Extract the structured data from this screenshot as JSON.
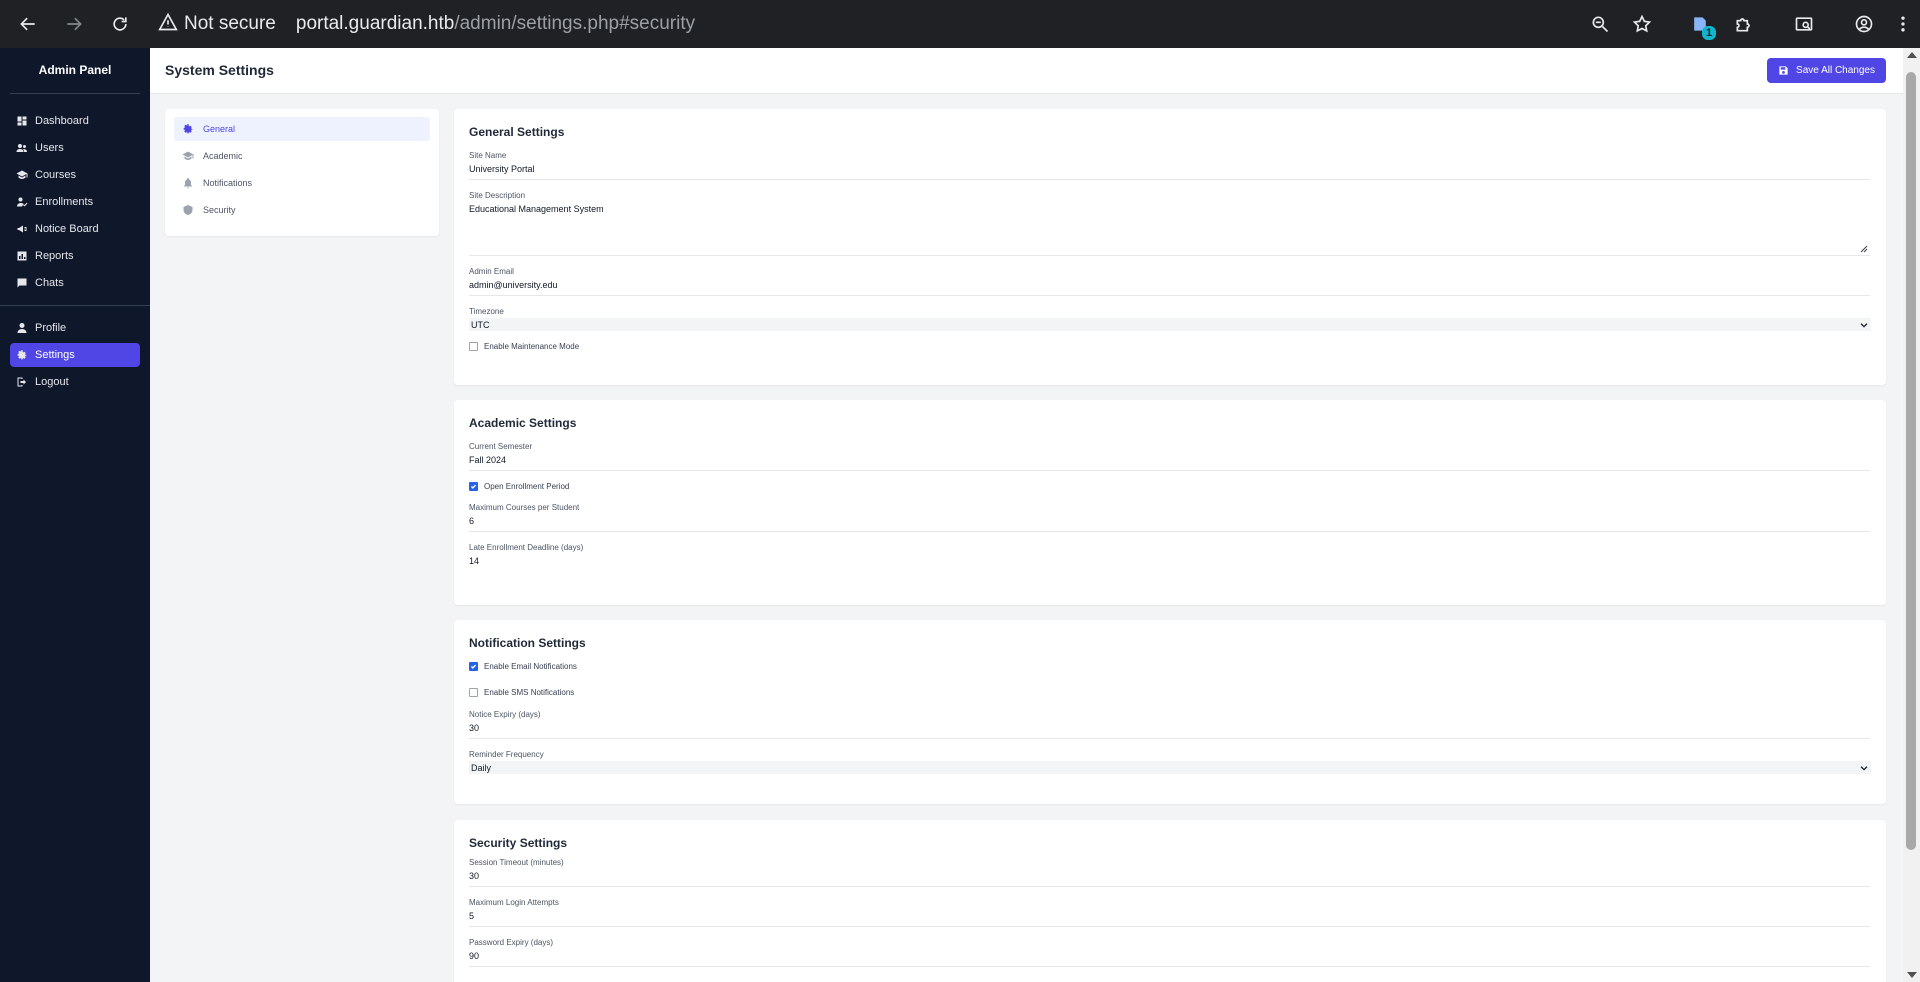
{
  "browser": {
    "not_secure": "Not secure",
    "url_host": "portal.guardian.htb",
    "url_path": "/admin/settings.php#security",
    "extension_badge": "1"
  },
  "sidebar": {
    "brand": "Admin Panel",
    "items": [
      {
        "label": "Dashboard",
        "icon": "dashboard-icon"
      },
      {
        "label": "Users",
        "icon": "users-icon"
      },
      {
        "label": "Courses",
        "icon": "graduation-cap-icon"
      },
      {
        "label": "Enrollments",
        "icon": "user-check-icon"
      },
      {
        "label": "Notice Board",
        "icon": "bullhorn-icon"
      },
      {
        "label": "Reports",
        "icon": "chart-icon"
      },
      {
        "label": "Chats",
        "icon": "chat-icon"
      }
    ],
    "bottom_items": [
      {
        "label": "Profile",
        "icon": "user-icon"
      },
      {
        "label": "Settings",
        "icon": "gear-icon",
        "active": true
      },
      {
        "label": "Logout",
        "icon": "logout-icon"
      }
    ]
  },
  "header": {
    "title": "System Settings",
    "save_label": "Save All Changes"
  },
  "settings_nav": [
    {
      "label": "General",
      "active": true
    },
    {
      "label": "Academic"
    },
    {
      "label": "Notifications"
    },
    {
      "label": "Security"
    }
  ],
  "general": {
    "title": "General Settings",
    "site_name_label": "Site Name",
    "site_name": "University Portal",
    "site_desc_label": "Site Description",
    "site_desc": "Educational Management System",
    "admin_email_label": "Admin Email",
    "admin_email": "admin@university.edu",
    "timezone_label": "Timezone",
    "timezone": "UTC",
    "maintenance_label": "Enable Maintenance Mode",
    "maintenance_checked": false
  },
  "academic": {
    "title": "Academic Settings",
    "semester_label": "Current Semester",
    "semester": "Fall 2024",
    "open_enrollment_label": "Open Enrollment Period",
    "open_enrollment_checked": true,
    "max_courses_label": "Maximum Courses per Student",
    "max_courses": "6",
    "late_deadline_label": "Late Enrollment Deadline (days)",
    "late_deadline": "14"
  },
  "notifications": {
    "title": "Notification Settings",
    "email_label": "Enable Email Notifications",
    "email_checked": true,
    "sms_label": "Enable SMS Notifications",
    "sms_checked": false,
    "expiry_label": "Notice Expiry (days)",
    "expiry": "30",
    "reminder_label": "Reminder Frequency",
    "reminder": "Daily"
  },
  "security": {
    "title": "Security Settings",
    "session_label": "Session Timeout (minutes)",
    "session": "30",
    "login_attempts_label": "Maximum Login Attempts",
    "login_attempts": "5",
    "password_expiry_label": "Password Expiry (days)",
    "password_expiry": "90"
  },
  "colors": {
    "accent": "#4f46e5",
    "sidebar_bg": "#0f172a",
    "checkbox": "#2563eb"
  }
}
